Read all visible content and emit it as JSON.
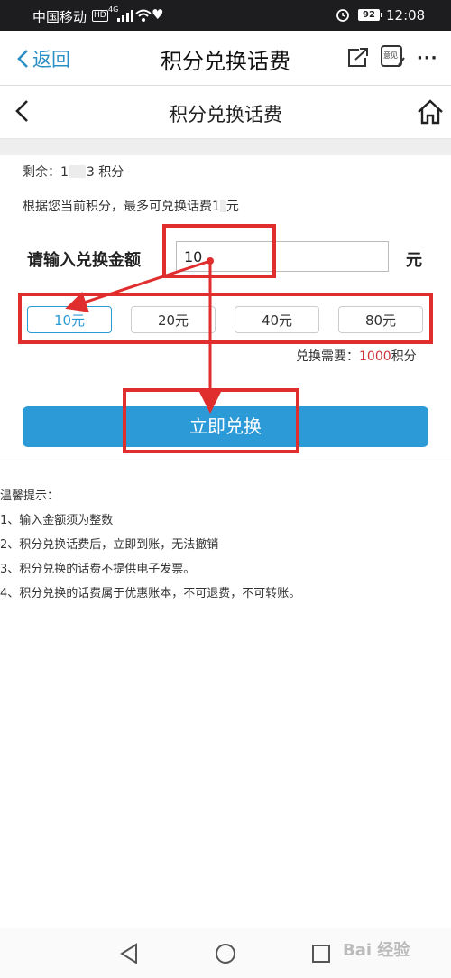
{
  "status_bar": {
    "carrier": "中国移动",
    "hd": "HD",
    "network": "4G",
    "battery": "92",
    "time": "12:08"
  },
  "app_header": {
    "back_label": "返回",
    "title": "积分兑换话费",
    "feedback_label": "意见",
    "more": "···"
  },
  "page_header": {
    "title": "积分兑换话费"
  },
  "balance": {
    "label": "剩余：",
    "value_prefix": "1",
    "value_suffix": "3 积分"
  },
  "max_info": {
    "text": "根据您当前积分，最多可兑换话费1",
    "suffix": "元"
  },
  "amount": {
    "label": "请输入兑换金额",
    "value": "10",
    "unit": "元"
  },
  "options": [
    {
      "label": "10元",
      "selected": true
    },
    {
      "label": "20元",
      "selected": false
    },
    {
      "label": "40元",
      "selected": false
    },
    {
      "label": "80元",
      "selected": false
    }
  ],
  "required": {
    "label": "兑换需要：",
    "value": "1000",
    "unit": "积分"
  },
  "exchange_button": "立即兑换",
  "tips": {
    "title": "温馨提示：",
    "items": [
      "1、输入金额须为整数",
      "2、积分兑换话费后，立即到账，无法撤销",
      "3、积分兑换的话费不提供电子发票。",
      "4、积分兑换的话费属于优惠账本，不可退费，不可转账。"
    ]
  },
  "watermark": "Bai 经验",
  "colors": {
    "accent": "#2d9ad8",
    "highlight": "#e02e2e",
    "value_red": "#d0333a"
  }
}
